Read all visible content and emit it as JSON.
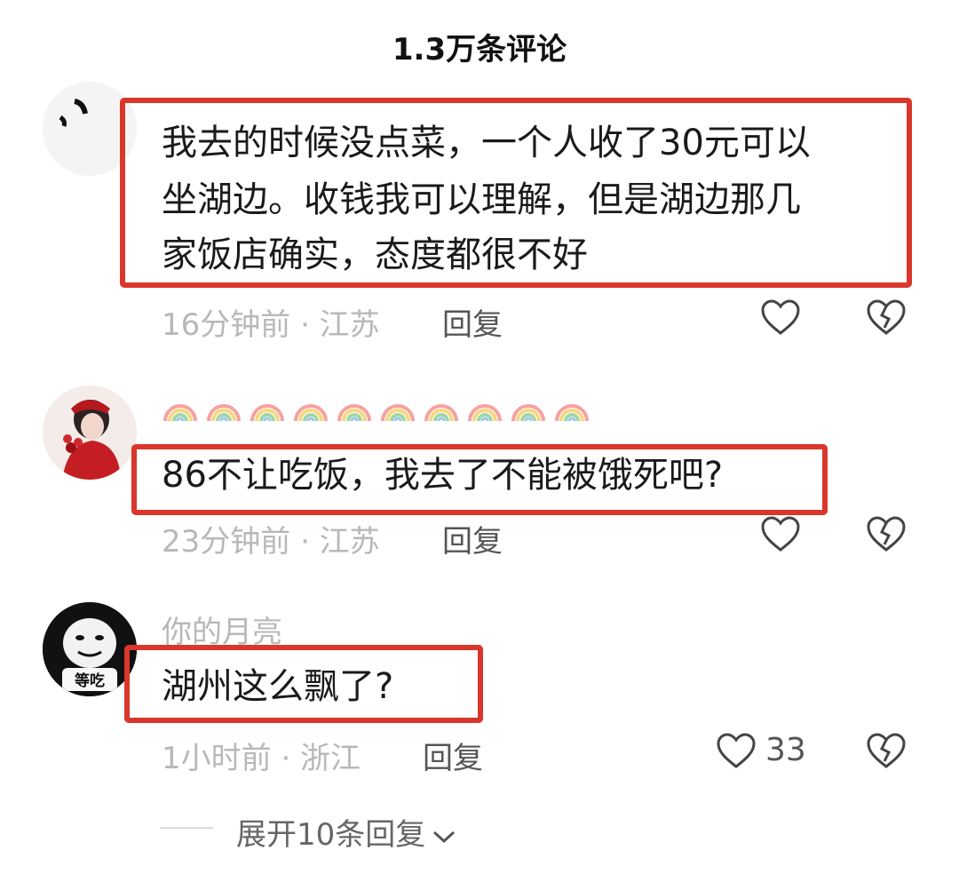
{
  "header": {
    "title": "1.3万条评论"
  },
  "comments": [
    {
      "username": "",
      "text_lines": [
        "我去的时候没点菜，一个人收了30元可以",
        "坐湖边。收钱我可以理解，但是湖边那几",
        "家饭店确实，态度都很不好"
      ],
      "meta": "16分钟前 · 江苏",
      "reply_label": "回复",
      "likes": ""
    },
    {
      "username": "",
      "text_lines": [
        "86不让吃饭，我去了不能被饿死吧?"
      ],
      "meta": "23分钟前 · 江苏",
      "reply_label": "回复",
      "likes": ""
    },
    {
      "username": "你的月亮",
      "avatar_caption": "等吃",
      "text_lines": [
        "湖州这么飘了?"
      ],
      "meta": "1小时前 · 浙江",
      "reply_label": "回复",
      "likes": "33"
    }
  ],
  "expand": {
    "label": "展开10条回复"
  },
  "colors": {
    "highlight_border": "#d9372b",
    "meta_gray": "#b8b8b8"
  },
  "icons": [
    "heart-outline-icon",
    "broken-heart-icon",
    "rainbow-emoji-icon",
    "chevron-down-icon"
  ]
}
